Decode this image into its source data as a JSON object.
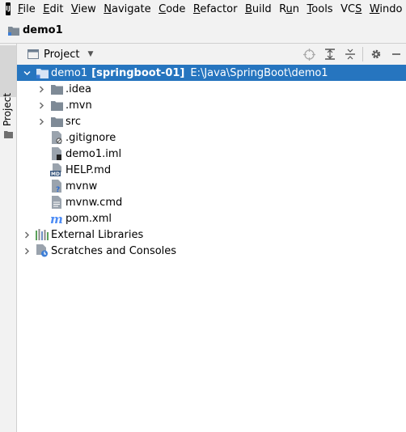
{
  "menubar": {
    "logo": "IJ",
    "items": [
      {
        "pre": "",
        "mn": "F",
        "post": "ile"
      },
      {
        "pre": "",
        "mn": "E",
        "post": "dit"
      },
      {
        "pre": "",
        "mn": "V",
        "post": "iew"
      },
      {
        "pre": "",
        "mn": "N",
        "post": "avigate"
      },
      {
        "pre": "",
        "mn": "C",
        "post": "ode"
      },
      {
        "pre": "",
        "mn": "R",
        "post": "efactor"
      },
      {
        "pre": "",
        "mn": "B",
        "post": "uild"
      },
      {
        "pre": "R",
        "mn": "u",
        "post": "n"
      },
      {
        "pre": "",
        "mn": "T",
        "post": "ools"
      },
      {
        "pre": "VC",
        "mn": "S",
        "post": ""
      },
      {
        "pre": "",
        "mn": "W",
        "post": "indo"
      }
    ]
  },
  "navbar": {
    "title": "demo1"
  },
  "left_strip": {
    "tab_label": "Project"
  },
  "tool_window": {
    "title": "Project"
  },
  "tree": {
    "root": {
      "name": "demo1",
      "module": "[springboot-01]",
      "path": "E:\\Java\\SpringBoot\\demo1"
    },
    "children": [
      ".idea",
      ".mvn",
      "src",
      ".gitignore",
      "demo1.iml",
      "HELP.md",
      "mvnw",
      "mvnw.cmd",
      "pom.xml"
    ],
    "external": "External Libraries",
    "scratches": "Scratches and Consoles"
  },
  "colors": {
    "selection": "#2675bf",
    "folder": "#7e8a96",
    "maven": "#4d8cf5"
  },
  "icons": [
    "app-logo-icon",
    "folder-icon",
    "project-view-icon",
    "locate-icon",
    "expand-all-icon",
    "collapse-all-icon",
    "gear-icon",
    "minimize-icon",
    "chevron-right-icon",
    "chevron-down-icon",
    "file-icon",
    "markdown-icon",
    "maven-icon",
    "library-icon",
    "scratches-icon"
  ]
}
